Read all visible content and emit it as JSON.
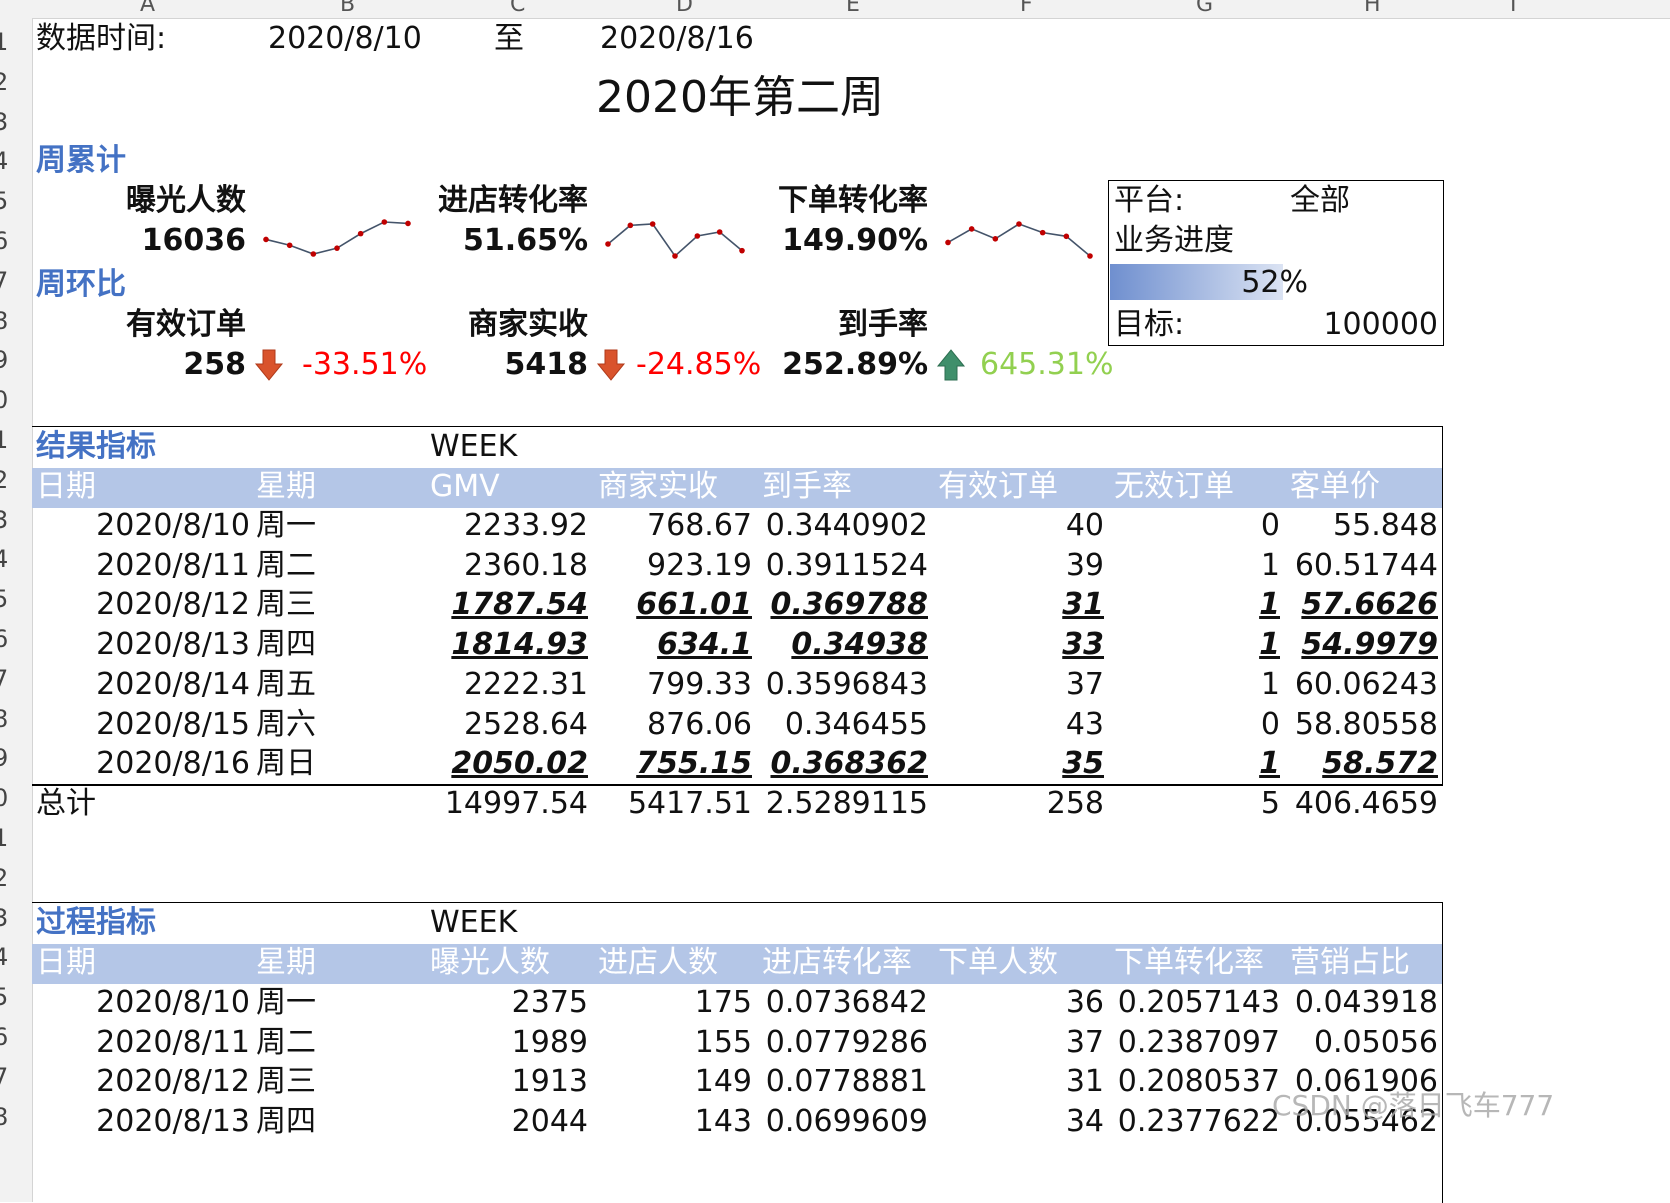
{
  "sheet": {
    "columns": [
      "A",
      "B",
      "C",
      "D",
      "E",
      "F",
      "G",
      "H",
      "I"
    ],
    "rows": [
      "1",
      "2",
      "3",
      "4",
      "5",
      "6",
      "7",
      "8",
      "9",
      "0",
      "1",
      "2",
      "3",
      "4",
      "5",
      "6",
      "7",
      "8",
      "9",
      "0",
      "1",
      "2",
      "3",
      "4",
      "5",
      "6",
      "7",
      "8"
    ]
  },
  "header": {
    "date_label": "数据时间:",
    "date_start": "2020/8/10",
    "to": "至",
    "date_end": "2020/8/16",
    "title": "2020年第二周"
  },
  "weekly_total": {
    "section": "周累计",
    "metrics": [
      {
        "label": "曝光人数",
        "value": "16036",
        "spark": [
          230,
          210,
          180,
          200,
          250,
          290,
          285
        ]
      },
      {
        "label": "进店转化率",
        "value": "51.65%",
        "spark": [
          0.4,
          0.68,
          0.7,
          0.22,
          0.52,
          0.58,
          0.3
        ]
      },
      {
        "label": "下单转化率",
        "value": "149.90%",
        "spark": [
          0.4,
          0.62,
          0.46,
          0.7,
          0.56,
          0.5,
          0.18
        ]
      }
    ]
  },
  "week_over_week": {
    "section": "周环比",
    "metrics": [
      {
        "label": "有效订单",
        "value": "258",
        "direction": "down",
        "change": "-33.51%",
        "color": "#ff0000"
      },
      {
        "label": "商家实收",
        "value": "5418",
        "direction": "down",
        "change": "-24.85%",
        "color": "#ff0000"
      },
      {
        "label": "到手率",
        "value": "252.89%",
        "direction": "up",
        "change": "645.31%",
        "color": "#92d050"
      }
    ]
  },
  "progress_box": {
    "platform_label": "平台:",
    "platform_value": "全部",
    "progress_label": "业务进度",
    "progress": 0.52,
    "progress_text": "52%",
    "target_label": "目标:",
    "target_value": "100000"
  },
  "result_table": {
    "title": "结果指标",
    "week": "WEEK",
    "headers": [
      "日期",
      "星期",
      "GMV",
      "商家实收",
      "到手率",
      "有效订单",
      "无效订单",
      "客单价"
    ],
    "rows": [
      {
        "date": "2020/8/10",
        "day": "周一",
        "v": [
          "2233.92",
          "768.67",
          "0.3440902",
          "40",
          "0",
          "55.848"
        ],
        "hl": false
      },
      {
        "date": "2020/8/11",
        "day": "周二",
        "v": [
          "2360.18",
          "923.19",
          "0.3911524",
          "39",
          "1",
          "60.51744"
        ],
        "hl": false
      },
      {
        "date": "2020/8/12",
        "day": "周三",
        "v": [
          "1787.54",
          "661.01",
          "0.369788",
          "31",
          "1",
          "57.6626"
        ],
        "hl": true
      },
      {
        "date": "2020/8/13",
        "day": "周四",
        "v": [
          "1814.93",
          "634.1",
          "0.34938",
          "33",
          "1",
          "54.9979"
        ],
        "hl": true
      },
      {
        "date": "2020/8/14",
        "day": "周五",
        "v": [
          "2222.31",
          "799.33",
          "0.3596843",
          "37",
          "1",
          "60.06243"
        ],
        "hl": false
      },
      {
        "date": "2020/8/15",
        "day": "周六",
        "v": [
          "2528.64",
          "876.06",
          "0.346455",
          "43",
          "0",
          "58.80558"
        ],
        "hl": false
      },
      {
        "date": "2020/8/16",
        "day": "周日",
        "v": [
          "2050.02",
          "755.15",
          "0.368362",
          "35",
          "1",
          "58.572"
        ],
        "hl": true
      }
    ],
    "total": {
      "label": "总计",
      "v": [
        "14997.54",
        "5417.51",
        "2.5289115",
        "258",
        "5",
        "406.4659"
      ]
    }
  },
  "process_table": {
    "title": "过程指标",
    "week": "WEEK",
    "headers": [
      "日期",
      "星期",
      "曝光人数",
      "进店人数",
      "进店转化率",
      "下单人数",
      "下单转化率",
      "营销占比"
    ],
    "rows": [
      {
        "date": "2020/8/10",
        "day": "周一",
        "v": [
          "2375",
          "175",
          "0.0736842",
          "36",
          "0.2057143",
          "0.043918"
        ]
      },
      {
        "date": "2020/8/11",
        "day": "周二",
        "v": [
          "1989",
          "155",
          "0.0779286",
          "37",
          "0.2387097",
          "0.05056"
        ]
      },
      {
        "date": "2020/8/12",
        "day": "周三",
        "v": [
          "1913",
          "149",
          "0.0778881",
          "31",
          "0.2080537",
          "0.061906"
        ]
      },
      {
        "date": "2020/8/13",
        "day": "周四",
        "v": [
          "2044",
          "143",
          "0.0699609",
          "34",
          "0.2377622",
          "0.055462"
        ]
      }
    ]
  },
  "watermark": "CSDN @落日飞车777"
}
